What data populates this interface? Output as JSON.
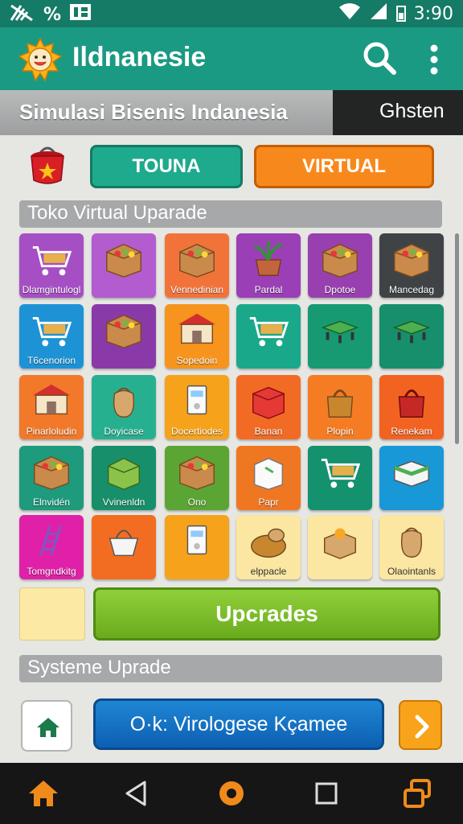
{
  "status_bar": {
    "left_text": "%",
    "time": "3:90"
  },
  "app_bar": {
    "title": "Ildnanesie",
    "search_icon": "search-icon",
    "more_icon": "more-vert-icon",
    "logo_icon": "smiley-sun-logo"
  },
  "sub_header": {
    "title": "Simulasi Bisenis Indanesia",
    "right_label": "Ghsten"
  },
  "modes": {
    "touna": "TOUNA",
    "virtual": "VIRTUAL"
  },
  "section_upgrade": {
    "title": "Toko Virtual Uparade"
  },
  "tiles": [
    {
      "label": "Dlamgintulogl",
      "color": "#a64fc4",
      "icon": "cart-stall-icon"
    },
    {
      "label": "",
      "color": "#b25ccf",
      "icon": "produce-box-icon"
    },
    {
      "label": "Vennedinian",
      "color": "#f2733a",
      "icon": "vegetable-crate-icon"
    },
    {
      "label": "Pardal",
      "color": "#9a3fb5",
      "icon": "potted-plant-icon"
    },
    {
      "label": "Dpotoe",
      "color": "#9940b0",
      "icon": "wooden-crate-icon"
    },
    {
      "label": "Mancedag",
      "color": "#3f4346",
      "icon": "goods-box-icon"
    },
    {
      "label": "T6cenorion",
      "color": "#1d93d6",
      "icon": "shopping-cart-icon"
    },
    {
      "label": "",
      "color": "#8a3aa8",
      "icon": "produce-box-icon"
    },
    {
      "label": "Sopedoin",
      "color": "#f7941d",
      "icon": "market-stall-icon"
    },
    {
      "label": "",
      "color": "#1aa88a",
      "icon": "shopping-cart-icon"
    },
    {
      "label": "",
      "color": "#179a72",
      "icon": "pallet-icon"
    },
    {
      "label": "",
      "color": "#178f6d",
      "icon": "pallet-icon"
    },
    {
      "label": "Pinarloludin",
      "color": "#f2792a",
      "icon": "market-stall-icon"
    },
    {
      "label": "Doyicase",
      "color": "#27b08f",
      "icon": "sack-icon"
    },
    {
      "label": "Docertiodes",
      "color": "#f7a21b",
      "icon": "appliance-icon"
    },
    {
      "label": "Banan",
      "color": "#f26b24",
      "icon": "red-box-icon"
    },
    {
      "label": "Plopin",
      "color": "#f57c22",
      "icon": "bag-icon"
    },
    {
      "label": "Renekam",
      "color": "#f26322",
      "icon": "handbag-icon"
    },
    {
      "label": "Elnvidén",
      "color": "#1e9a7c",
      "icon": "produce-crate-icon"
    },
    {
      "label": "Vvinenldn",
      "color": "#178f6a",
      "icon": "green-box-icon"
    },
    {
      "label": "Ono",
      "color": "#5ba534",
      "icon": "vegetable-crate-icon"
    },
    {
      "label": "Papr",
      "color": "#f07722",
      "icon": "paper-box-icon"
    },
    {
      "label": "",
      "color": "#14916f",
      "icon": "shopping-cart-icon"
    },
    {
      "label": "",
      "color": "#1998d8",
      "icon": "storage-box-icon"
    },
    {
      "label": "Tomgndkitg",
      "color": "#e020a8",
      "icon": "ladder-cart-icon"
    },
    {
      "label": "",
      "color": "#f26d22",
      "icon": "basket-icon"
    },
    {
      "label": "",
      "color": "#f7a21b",
      "icon": "appliance-icon"
    },
    {
      "label": "elppacle",
      "color": "#fbe6a2",
      "icon": "bread-basket-icon",
      "light": true
    },
    {
      "label": "",
      "color": "#fbe6a2",
      "icon": "fruit-crate-icon",
      "light": true
    },
    {
      "label": "Olaointanls",
      "color": "#fbe6a2",
      "icon": "sack-wood-icon",
      "light": true
    }
  ],
  "upgrade_button": {
    "label": "Upcrades"
  },
  "section_system": {
    "title": "Systeme Uprade"
  },
  "bottom_actions": {
    "main_label": "O·k: Virologese  Kçamee",
    "home_icon": "home-icon",
    "next_icon": "chevron-right-icon"
  },
  "nav_bar": {
    "items": [
      "home-icon",
      "back-icon",
      "home-circle-icon",
      "recents-icon",
      "switch-icon"
    ]
  },
  "colors": {
    "primary": "#1a9a82",
    "accent": "#f7891c",
    "upgrade": "#7bbf2a",
    "action": "#1472c4"
  }
}
